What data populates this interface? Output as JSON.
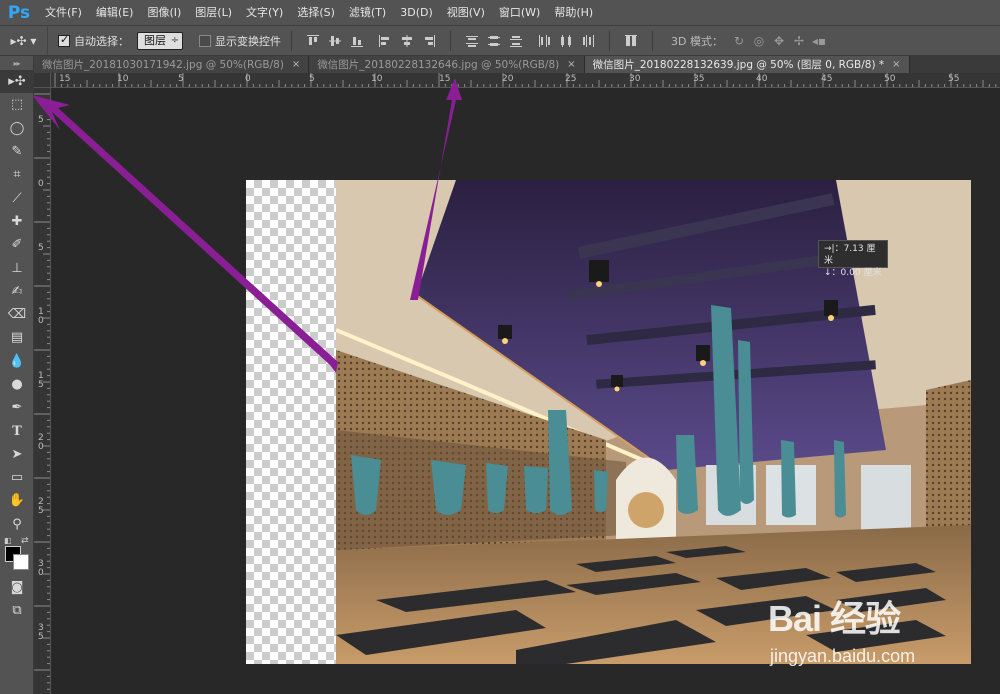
{
  "app": {
    "logo": "Ps"
  },
  "menu": [
    "文件(F)",
    "编辑(E)",
    "图像(I)",
    "图层(L)",
    "文字(Y)",
    "选择(S)",
    "滤镜(T)",
    "3D(D)",
    "视图(V)",
    "窗口(W)",
    "帮助(H)"
  ],
  "options": {
    "tool_glyph": "▸✣ ▾",
    "auto_select_label": "自动选择：",
    "auto_select_checked": true,
    "auto_select_target": "图层",
    "show_transform_label": "显示变换控件",
    "show_transform_checked": false,
    "mode_label": "3D 模式："
  },
  "tabs": [
    {
      "label": "微信图片_20181030171942.jpg @ 50%(RGB/8)",
      "close": "×",
      "active": false
    },
    {
      "label": "微信图片_20180228132646.jpg @ 50%(RGB/8)",
      "close": "×",
      "active": false
    },
    {
      "label": "微信图片_20180228132639.jpg @ 50% (图层 0, RGB/8) *",
      "close": "×",
      "active": true
    }
  ],
  "ruler_top": [
    "15",
    "10",
    "5",
    "0",
    "5",
    "10",
    "15",
    "20",
    "25",
    "30",
    "35",
    "40",
    "45",
    "50",
    "55"
  ],
  "ruler_left": [
    "5",
    "0",
    "5",
    "1 0",
    "1 5",
    "2 0",
    "2 5",
    "3 0",
    "3 5"
  ],
  "measure": {
    "line1": "→|：7.13 厘米",
    "line2": "↓：0.00 厘米"
  },
  "watermark": {
    "brand": "Bai 经验",
    "url": "jingyan.baidu.com"
  },
  "colors": {
    "arrow": "#8a1f95",
    "ps_blue": "#31a8ff",
    "panel": "#535353",
    "workspace": "#282828"
  }
}
